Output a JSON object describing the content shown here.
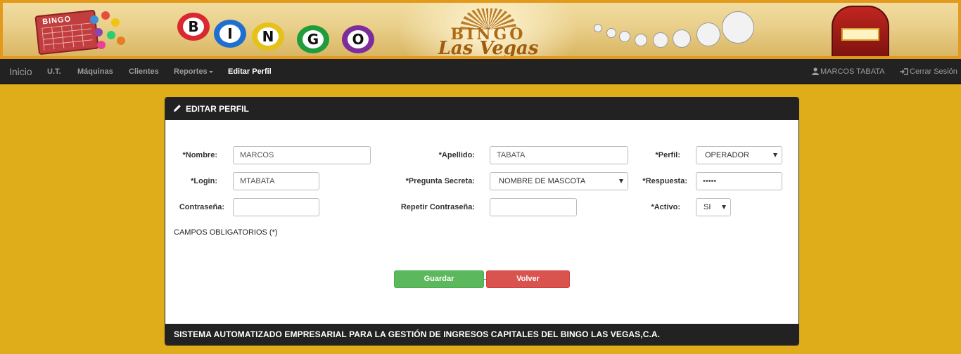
{
  "banner": {
    "card_text": "BINGO",
    "balls": [
      "B",
      "I",
      "N",
      "G",
      "O"
    ],
    "logo_top": "BINGO",
    "logo_bottom": "Las Vegas"
  },
  "nav": {
    "brand": "Inicio",
    "items": [
      "U.T.",
      "Máquinas",
      "Clientes",
      "Reportes",
      "Editar Perfil"
    ],
    "active": "Editar Perfil",
    "user": "MARCOS TABATA",
    "logout": "Cerrar Sesión"
  },
  "panel": {
    "title": "EDITAR PERFIL",
    "footer": "SISTEMA AUTOMATIZADO EMPRESARIAL PARA LA GESTIÓN DE INGRESOS CAPITALES DEL BINGO LAS VEGAS,C.A."
  },
  "form": {
    "nombre_label": "*Nombre:",
    "nombre_value": "MARCOS",
    "apellido_label": "*Apellido:",
    "apellido_value": "TABATA",
    "perfil_label": "*Perfil:",
    "perfil_value": "OPERADOR",
    "login_label": "*Login:",
    "login_value": "MTABATA",
    "pregunta_label": "*Pregunta Secreta:",
    "pregunta_value": "NOMBRE DE MASCOTA",
    "respuesta_label": "*Respuesta:",
    "respuesta_value": "•••••",
    "contrasena_label": "Contraseña:",
    "contrasena_value": "",
    "repetir_label": "Repetir Contraseña:",
    "repetir_value": "",
    "activo_label": "*Activo:",
    "activo_value": "SI",
    "required_note": "CAMPOS OBLIGATORIOS (*)"
  },
  "buttons": {
    "save": "Guardar",
    "back": "Volver"
  },
  "colors": {
    "page_bg": "#e0ad1a",
    "navbar": "#222222",
    "save": "#5cb85c",
    "back": "#d9534f"
  }
}
